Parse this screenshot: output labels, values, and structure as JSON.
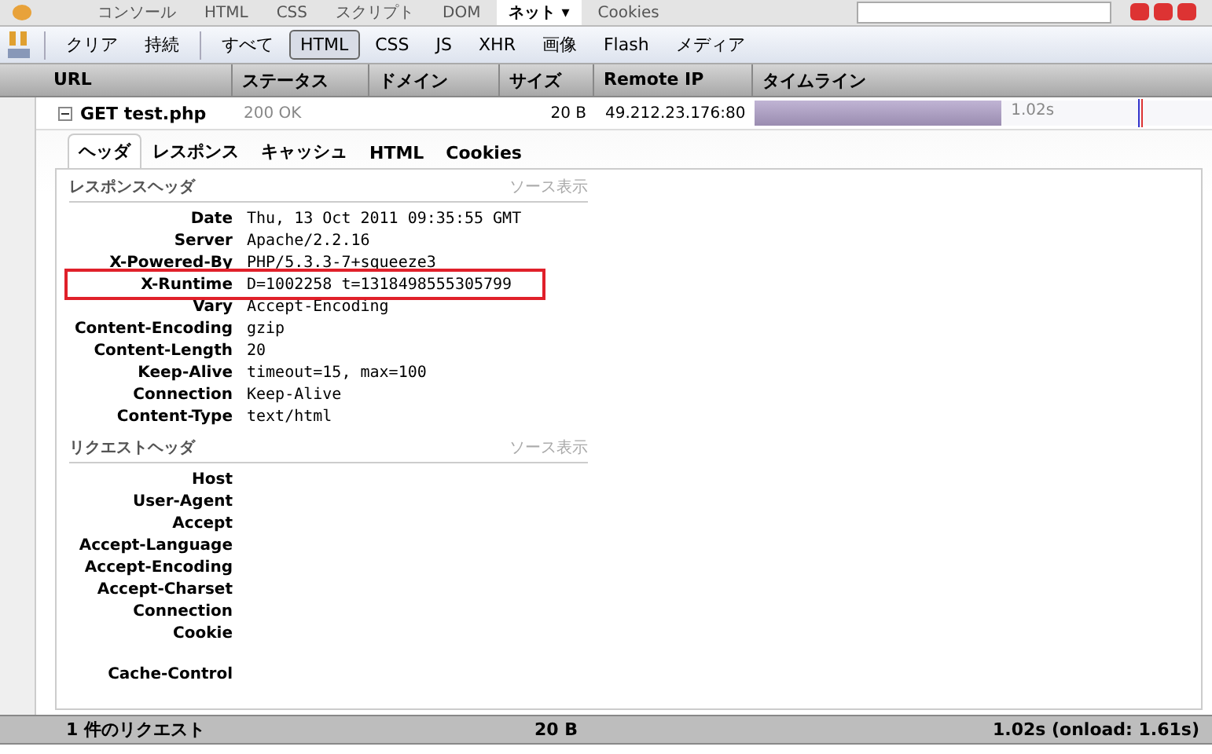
{
  "panel_tabs": [
    {
      "label": "コンソール",
      "selected": false
    },
    {
      "label": "HTML",
      "selected": false
    },
    {
      "label": "CSS",
      "selected": false
    },
    {
      "label": "スクリプト",
      "selected": false
    },
    {
      "label": "DOM",
      "selected": false
    },
    {
      "label": "ネット ▾",
      "selected": true
    },
    {
      "label": "Cookies",
      "selected": false
    }
  ],
  "filters": {
    "actions": [
      "クリア",
      "持続"
    ],
    "types": [
      {
        "label": "すべて",
        "selected": false
      },
      {
        "label": "HTML",
        "selected": true
      },
      {
        "label": "CSS",
        "selected": false
      },
      {
        "label": "JS",
        "selected": false
      },
      {
        "label": "XHR",
        "selected": false
      },
      {
        "label": "画像",
        "selected": false
      },
      {
        "label": "Flash",
        "selected": false
      },
      {
        "label": "メディア",
        "selected": false
      }
    ]
  },
  "table": {
    "columns": [
      "URL",
      "ステータス",
      "ドメイン",
      "サイズ",
      "Remote IP",
      "タイムライン"
    ],
    "request": {
      "expanded": true,
      "url": "GET test.php",
      "status": "200 OK",
      "size": "20 B",
      "remote_ip": "49.212.23.176:80",
      "level": 0.54,
      "time": "1.02s"
    }
  },
  "details": {
    "tabs": [
      {
        "label": "ヘッダ",
        "selected": true
      },
      {
        "label": "レスポンス",
        "selected": false
      },
      {
        "label": "キャッシュ",
        "selected": false
      },
      {
        "label": "HTML",
        "selected": false
      },
      {
        "label": "Cookies",
        "selected": false
      }
    ],
    "sections": [
      {
        "title": "レスポンスヘッダ",
        "source_link": "ソース表示",
        "headers": [
          {
            "name": "Date",
            "value": "Thu, 13 Oct 2011 09:35:55 GMT",
            "highlighted": false
          },
          {
            "name": "Server",
            "value": "Apache/2.2.16",
            "highlighted": false
          },
          {
            "name": "X-Powered-By",
            "value": "PHP/5.3.3-7+squeeze3",
            "highlighted": false
          },
          {
            "name": "X-Runtime",
            "value": "D=1002258 t=1318498555305799",
            "highlighted": true
          },
          {
            "name": "Vary",
            "value": "Accept-Encoding",
            "highlighted": false
          },
          {
            "name": "Content-Encoding",
            "value": "gzip",
            "highlighted": false
          },
          {
            "name": "Content-Length",
            "value": "20",
            "highlighted": false
          },
          {
            "name": "Keep-Alive",
            "value": "timeout=15, max=100",
            "highlighted": false
          },
          {
            "name": "Connection",
            "value": "Keep-Alive",
            "highlighted": false
          },
          {
            "name": "Content-Type",
            "value": "text/html",
            "highlighted": false
          }
        ]
      },
      {
        "title": "リクエストヘッダ",
        "source_link": "ソース表示",
        "headers": [
          {
            "name": "Host",
            "gap_before": false
          },
          {
            "name": "User-Agent",
            "gap_before": false
          },
          {
            "name": "Accept",
            "gap_before": false
          },
          {
            "name": "Accept-Language",
            "gap_before": false
          },
          {
            "name": "Accept-Encoding",
            "gap_before": false
          },
          {
            "name": "Accept-Charset",
            "gap_before": false
          },
          {
            "name": "Connection",
            "gap_before": false
          },
          {
            "name": "Cookie",
            "gap_before": false
          },
          {
            "name": "Cache-Control",
            "gap_before": true
          }
        ]
      }
    ]
  },
  "status_bar": {
    "count": "1 件のリクエスト",
    "size": "20 B",
    "time": "1.02s (onload: 1.61s)"
  }
}
